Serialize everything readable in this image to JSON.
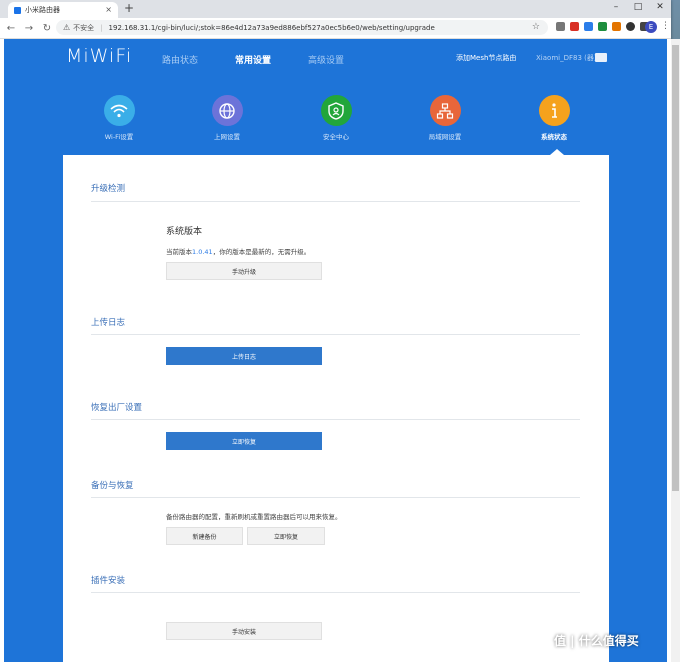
{
  "browser": {
    "tab_title": "小米路由器",
    "tab_close": "×",
    "new_tab": "+",
    "insecure_label": "不安全",
    "url": "192.168.31.1/cgi-bin/luci/;stok=86e4d12a73a9ed886ebf527a0ec5b6e0/web/setting/upgrade",
    "avatar_letter": "E"
  },
  "header": {
    "logo": "MiWiFi",
    "nav": [
      "路由状态",
      "常用设置",
      "高级设置"
    ],
    "active_nav": "常用设置",
    "mesh_link": "添加Mesh节点路由",
    "device": "Xiaomi_DF83 (器)"
  },
  "icons": [
    {
      "label": "Wi-Fi设置",
      "color": "#3aaee8",
      "icon": "wifi-icon"
    },
    {
      "label": "上网设置",
      "color": "#6c73d9",
      "icon": "globe-icon"
    },
    {
      "label": "安全中心",
      "color": "#22a63a",
      "icon": "shield-icon"
    },
    {
      "label": "局域网设置",
      "color": "#e8663a",
      "icon": "network-icon"
    },
    {
      "label": "系统状态",
      "color": "#f5a21d",
      "icon": "info-icon"
    }
  ],
  "sections": {
    "upgrade": {
      "title": "升级检测",
      "heading": "系统版本",
      "desc_prefix": "当前版本",
      "version": "1.0.41",
      "desc_suffix": "，你的版本是最新的，无需升级。",
      "button": "手动升级"
    },
    "log": {
      "title": "上传日志",
      "button": "上传日志"
    },
    "reset": {
      "title": "恢复出厂设置",
      "button": "立即恢复"
    },
    "backup": {
      "title": "备份与恢复",
      "desc": "备份路由器的配置，重新刷机或重置路由器后可以用来恢复。",
      "new_button": "新建备份",
      "restore_button": "立即恢复"
    },
    "plugin": {
      "title": "插件安装",
      "button": "手动安装"
    }
  },
  "watermark": "值 | 什么值得买"
}
